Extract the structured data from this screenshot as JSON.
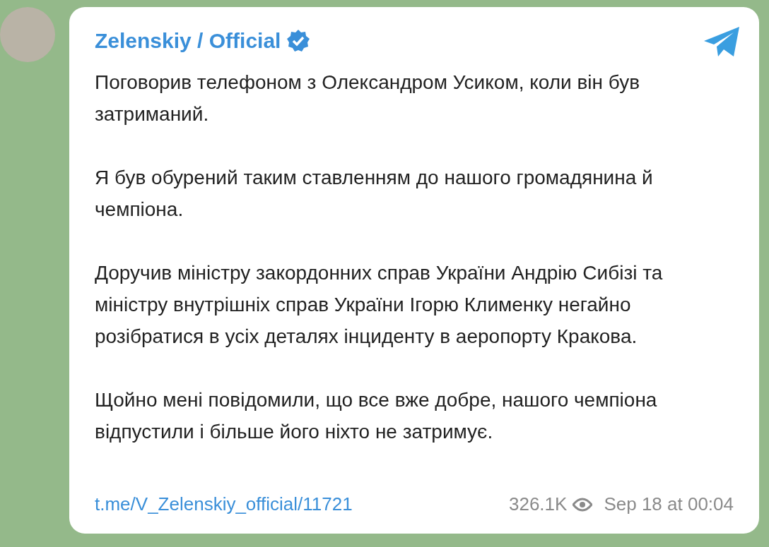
{
  "post": {
    "author": "Zelenskiy / Official",
    "verified": true,
    "paragraphs": [
      "Поговорив телефоном з Олександром Усиком, коли він був затриманий.",
      "Я був обурений таким ставленням до нашого громадянина й чемпіона.",
      "Доручив міністру закордонних справ України Андрію Сибізі та міністру внутрішніх справ України Ігорю Клименку негайно розібратися в усіх деталях інциденту в аеропорту Кракова.",
      "Щойно мені повідомили, що все вже добре, нашого чемпіона відпустили і більше його ніхто не затримує."
    ],
    "link": "t.me/V_Zelenskiy_official/11721",
    "views": "326.1K",
    "date": "Sep 18 at 00:04"
  }
}
